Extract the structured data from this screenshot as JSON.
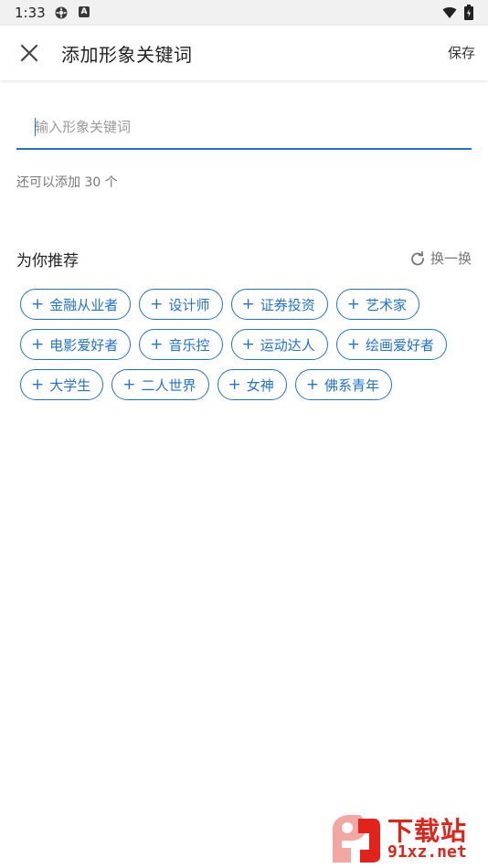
{
  "status_bar": {
    "time": "1:33",
    "icon_badge": "A",
    "icons": [
      "settings-app-icon",
      "a-badge-icon",
      "wifi-icon",
      "battery-icon"
    ]
  },
  "app_bar": {
    "title": "添加形象关键词",
    "save_label": "保存",
    "close_icon": "close-icon"
  },
  "input": {
    "placeholder": "输入形象关键词",
    "value": ""
  },
  "remaining_text": "还可以添加 30 个",
  "recommend": {
    "title": "为你推荐",
    "refresh_label": "换一换",
    "refresh_icon": "refresh-icon",
    "chip_prefix": "+",
    "rows": [
      [
        "金融从业者",
        "设计师",
        "证券投资",
        "艺术家"
      ],
      [
        "电影爱好者",
        "音乐控",
        "运动达人",
        "绘画爱好者"
      ],
      [
        "大学生",
        "二人世界",
        "女神",
        "佛系青年"
      ]
    ]
  },
  "watermark": {
    "cn": "下载站",
    "en": "91xz.net"
  },
  "colors": {
    "accent": "#1e73d6",
    "watermark": "#e2231a",
    "status_bar_bg": "#f1f1f1"
  }
}
